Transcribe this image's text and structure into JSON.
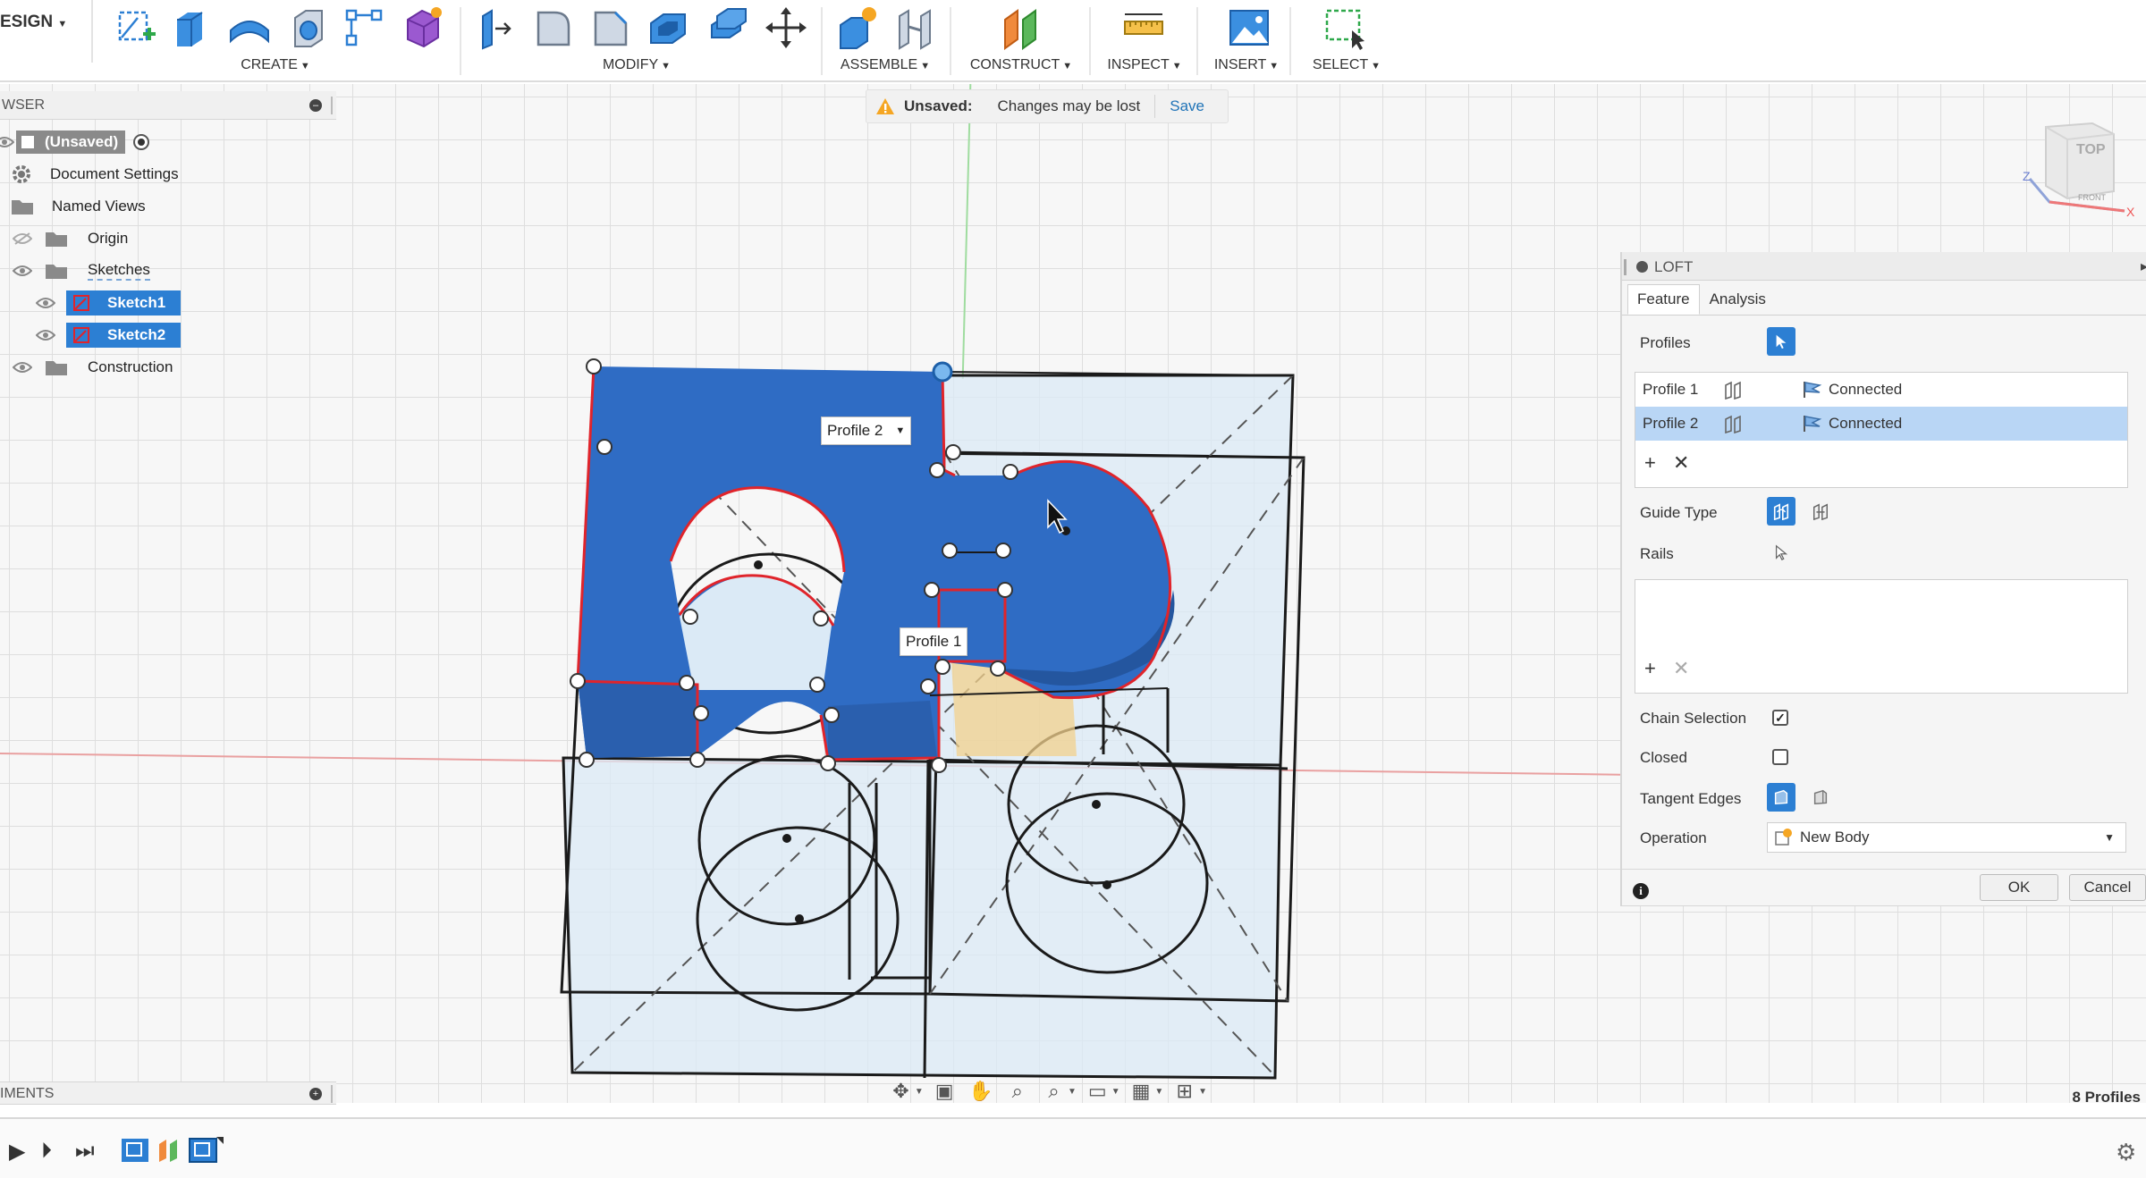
{
  "toolbar": {
    "workspace": "ESIGN",
    "groups": {
      "create": "CREATE",
      "modify": "MODIFY",
      "assemble": "ASSEMBLE",
      "construct": "CONSTRUCT",
      "inspect": "INSPECT",
      "insert": "INSERT",
      "select": "SELECT"
    },
    "icons": [
      "create-sketch-icon",
      "extrude-icon",
      "revolve-icon",
      "hole-icon",
      "pattern-icon",
      "form-icon",
      "press-pull-icon",
      "fillet-icon",
      "chamfer-icon",
      "shell-icon",
      "combine-icon",
      "move-icon",
      "new-component-icon",
      "joint-icon",
      "offset-plane-icon",
      "measure-icon",
      "insert-image-icon",
      "select-icon"
    ]
  },
  "banner": {
    "title": "Unsaved:",
    "message": "Changes may be lost",
    "action": "Save"
  },
  "browser": {
    "header": "WSER",
    "items": [
      {
        "label": "(Unsaved)"
      },
      {
        "label": "Document Settings"
      },
      {
        "label": "Named Views"
      },
      {
        "label": "Origin"
      },
      {
        "label": "Sketches"
      },
      {
        "label": "Sketch1"
      },
      {
        "label": "Sketch2"
      },
      {
        "label": "Construction"
      }
    ]
  },
  "comments": {
    "header": "IMENTS"
  },
  "scene": {
    "profile_tags": [
      "Profile 2",
      "Profile 1"
    ]
  },
  "status": {
    "profiles": "8 Profiles"
  },
  "loft": {
    "title": "LOFT",
    "tabs": [
      "Feature",
      "Analysis"
    ],
    "profiles_label": "Profiles",
    "profile_rows": [
      {
        "name": "Profile 1",
        "continuity": "Connected",
        "selected": false
      },
      {
        "name": "Profile 2",
        "continuity": "Connected",
        "selected": true
      }
    ],
    "guide_type_label": "Guide Type",
    "rails_label": "Rails",
    "chain_selection_label": "Chain Selection",
    "chain_selection": true,
    "closed_label": "Closed",
    "closed": false,
    "tangent_edges_label": "Tangent Edges",
    "operation_label": "Operation",
    "operation_value": "New Body",
    "ok": "OK",
    "cancel": "Cancel"
  },
  "viewcube": {
    "top": "TOP",
    "front": "FRONT",
    "axis_z": "Z",
    "axis_x": "X"
  },
  "colors": {
    "accent": "#2c7fd3",
    "profile_fill": "#2f6cc4",
    "selection_edge": "#e0242b",
    "warning": "#f5a623"
  }
}
